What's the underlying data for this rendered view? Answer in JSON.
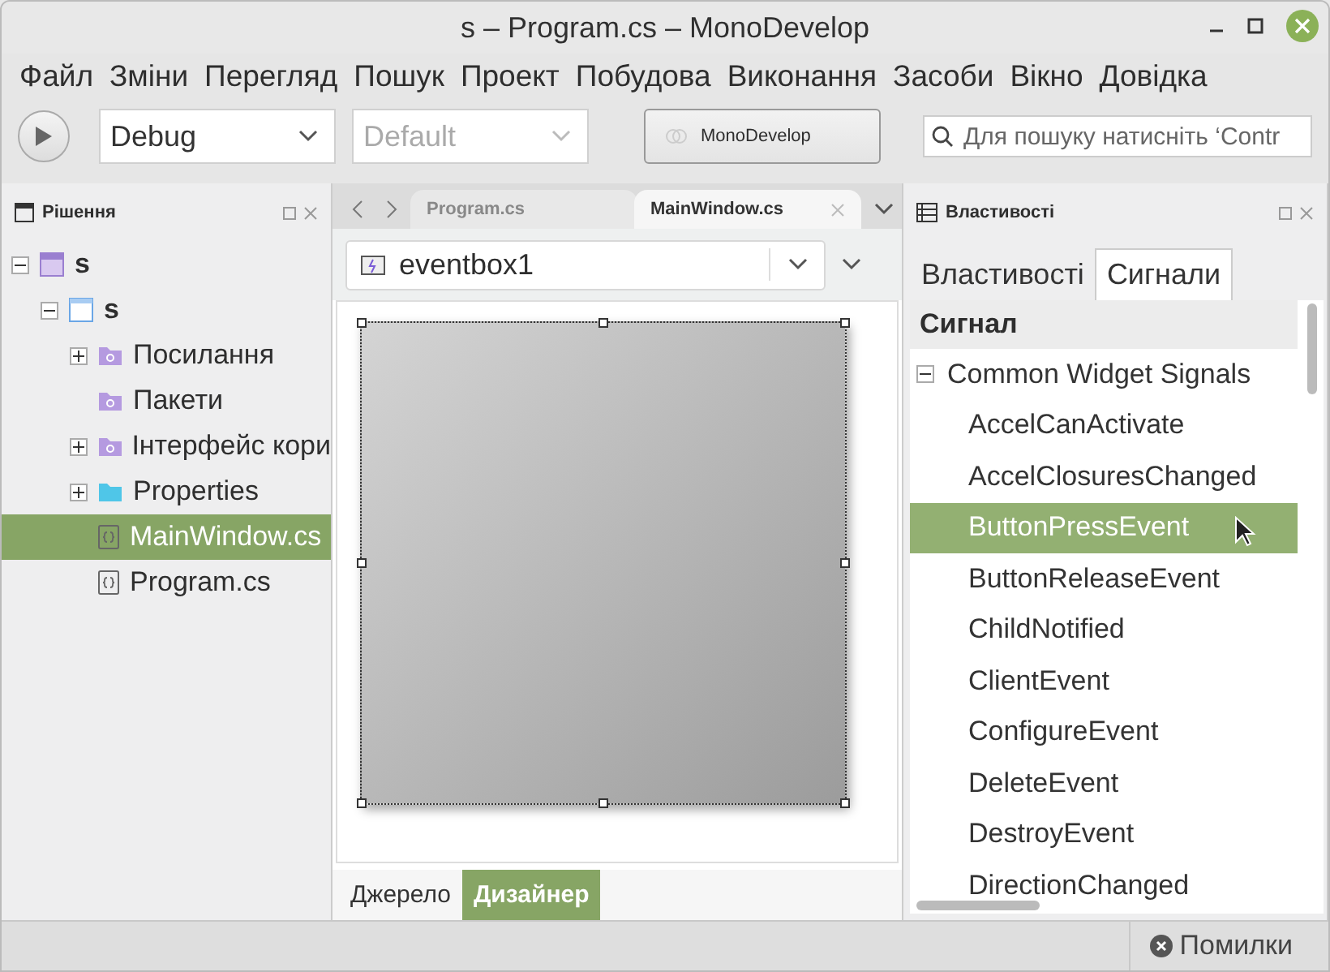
{
  "window": {
    "title": "s – Program.cs – MonoDevelop"
  },
  "menu": [
    "Файл",
    "Зміни",
    "Перегляд",
    "Пошук",
    "Проект",
    "Побудова",
    "Виконання",
    "Засоби",
    "Вікно",
    "Довідка"
  ],
  "toolbar": {
    "configuration": "Debug",
    "platform": "Default",
    "platform_disabled": true,
    "status": "MonoDevelop",
    "search": {
      "placeholder": "Для пошуку натисніть ‘Contr"
    }
  },
  "solution_panel": {
    "title": "Рішення",
    "tree": [
      {
        "label": "s",
        "kind": "solution",
        "expanded": true,
        "selected": false,
        "children": [
          {
            "label": "s",
            "kind": "project",
            "expanded": true,
            "selected": false,
            "children": [
              {
                "label": "Посилання",
                "kind": "references",
                "expanded": false,
                "selected": false
              },
              {
                "label": "Пакети",
                "kind": "packages",
                "selected": false
              },
              {
                "label": "Інтерфейс кори",
                "kind": "interface",
                "expanded": false,
                "selected": false
              },
              {
                "label": "Properties",
                "kind": "folder",
                "expanded": false,
                "selected": false
              },
              {
                "label": "MainWindow.cs",
                "kind": "file",
                "selected": true
              },
              {
                "label": "Program.cs",
                "kind": "file",
                "selected": false
              }
            ]
          }
        ]
      }
    ]
  },
  "editor": {
    "tabs": [
      {
        "label": "Program.cs",
        "selected": false
      },
      {
        "label": "MainWindow.cs",
        "selected": true
      }
    ],
    "widget_selector": "eventbox1",
    "view_tabs": [
      {
        "label": "Джерело",
        "selected": false
      },
      {
        "label": "Дизайнер",
        "selected": true
      }
    ]
  },
  "properties_panel": {
    "title": "Властивості",
    "tabs": [
      {
        "label": "Властивості",
        "selected": false
      },
      {
        "label": "Сигнали",
        "selected": true
      }
    ],
    "column": "Сигнал",
    "groups": [
      {
        "label": "Common Widget Signals",
        "expanded": true,
        "signals": [
          {
            "label": "AccelCanActivate",
            "selected": false
          },
          {
            "label": "AccelClosuresChanged",
            "selected": false
          },
          {
            "label": "ButtonPressEvent",
            "selected": true
          },
          {
            "label": "ButtonReleaseEvent",
            "selected": false
          },
          {
            "label": "ChildNotified",
            "selected": false
          },
          {
            "label": "ClientEvent",
            "selected": false
          },
          {
            "label": "ConfigureEvent",
            "selected": false
          },
          {
            "label": "DeleteEvent",
            "selected": false
          },
          {
            "label": "DestroyEvent",
            "selected": false
          },
          {
            "label": "DirectionChanged",
            "selected": false
          }
        ]
      }
    ]
  },
  "status_bar": {
    "errors_button": "Помилки"
  }
}
